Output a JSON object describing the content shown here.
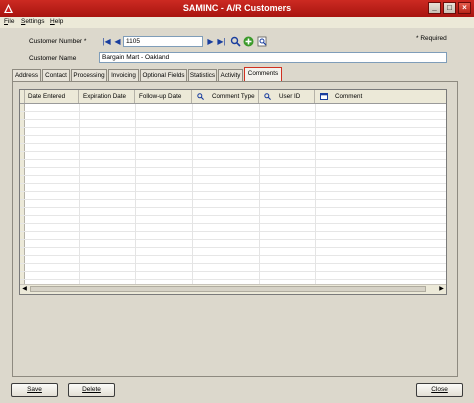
{
  "window": {
    "title": "SAMINC - A/R Customers"
  },
  "menu": [
    {
      "label": "File",
      "hotkey": "F",
      "rest": "ile"
    },
    {
      "label": "Settings",
      "hotkey": "S",
      "rest": "ettings"
    },
    {
      "label": "Help",
      "hotkey": "H",
      "rest": "elp"
    }
  ],
  "form": {
    "customer_number_label": "Customer Number *",
    "customer_number_value": "1105",
    "customer_name_label": "Customer Name",
    "customer_name_value": "Bargain Mart - Oakland",
    "required_note": "* Required"
  },
  "tabs": [
    "Address",
    "Contact",
    "Processing",
    "Invoicing",
    "Optional Fields",
    "Statistics",
    "Activity",
    "Comments"
  ],
  "active_tab": "Comments",
  "grid": {
    "columns": [
      "Date Entered",
      "Expiration Date",
      "Follow-up Date",
      "Comment Type",
      "User ID",
      "Comment"
    ],
    "rows": []
  },
  "buttons": {
    "save": "Save",
    "delete": "Delete",
    "close": "Close"
  }
}
